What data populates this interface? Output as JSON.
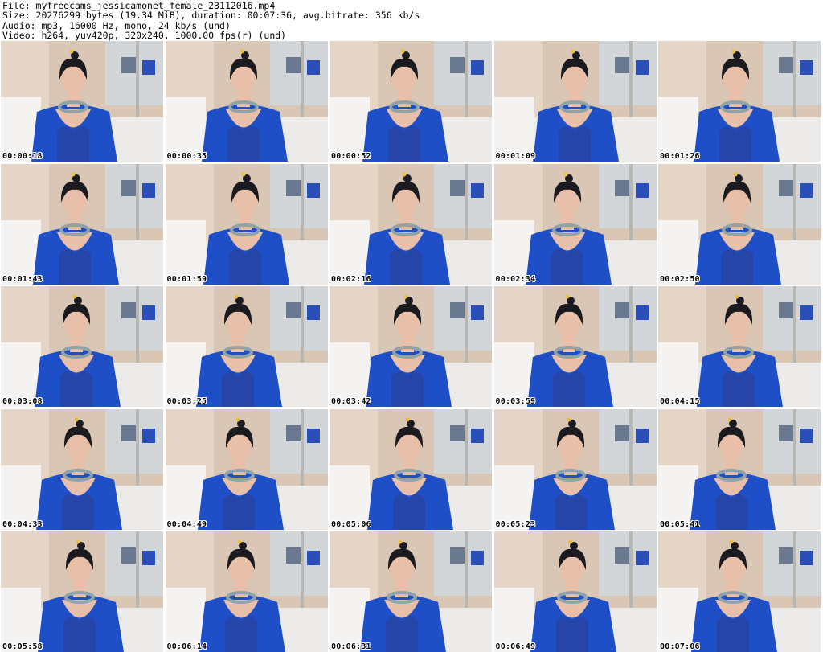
{
  "header": {
    "line1": "File: myfreecams_jessicamonet_female_23112016.mp4",
    "line2": "Size: 20276299 bytes (19.34 MiB), duration: 00:07:36, avg.bitrate: 356 kb/s",
    "line3": "Audio: mp3, 16000 Hz, mono, 24 kb/s (und)",
    "line4": "Video: h264, yuv420p, 320x240, 1000.00 fps(r) (und)"
  },
  "colors": {
    "wall": "#d9c6b4",
    "bed": "#ecebea",
    "robe": "#1f4fc7",
    "hair": "#1a1a1f",
    "skin": "#e8bfa8",
    "necklace": "#8fa3a8"
  },
  "thumbnails": [
    {
      "time": "00:00:18",
      "icon": "video-frame-icon"
    },
    {
      "time": "00:00:35",
      "icon": "video-frame-icon"
    },
    {
      "time": "00:00:52",
      "icon": "video-frame-icon"
    },
    {
      "time": "00:01:09",
      "icon": "video-frame-icon"
    },
    {
      "time": "00:01:26",
      "icon": "video-frame-icon"
    },
    {
      "time": "00:01:43",
      "icon": "video-frame-icon"
    },
    {
      "time": "00:01:59",
      "icon": "video-frame-icon"
    },
    {
      "time": "00:02:16",
      "icon": "video-frame-icon"
    },
    {
      "time": "00:02:34",
      "icon": "video-frame-icon"
    },
    {
      "time": "00:02:50",
      "icon": "video-frame-icon"
    },
    {
      "time": "00:03:08",
      "icon": "video-frame-icon"
    },
    {
      "time": "00:03:25",
      "icon": "video-frame-icon"
    },
    {
      "time": "00:03:42",
      "icon": "video-frame-icon"
    },
    {
      "time": "00:03:59",
      "icon": "video-frame-icon"
    },
    {
      "time": "00:04:15",
      "icon": "video-frame-icon"
    },
    {
      "time": "00:04:33",
      "icon": "video-frame-icon"
    },
    {
      "time": "00:04:49",
      "icon": "video-frame-icon"
    },
    {
      "time": "00:05:06",
      "icon": "video-frame-icon"
    },
    {
      "time": "00:05:23",
      "icon": "video-frame-icon"
    },
    {
      "time": "00:05:41",
      "icon": "video-frame-icon"
    },
    {
      "time": "00:05:58",
      "icon": "video-frame-icon"
    },
    {
      "time": "00:06:14",
      "icon": "video-frame-icon"
    },
    {
      "time": "00:06:31",
      "icon": "video-frame-icon"
    },
    {
      "time": "00:06:49",
      "icon": "video-frame-icon"
    },
    {
      "time": "00:07:06",
      "icon": "video-frame-icon"
    }
  ]
}
